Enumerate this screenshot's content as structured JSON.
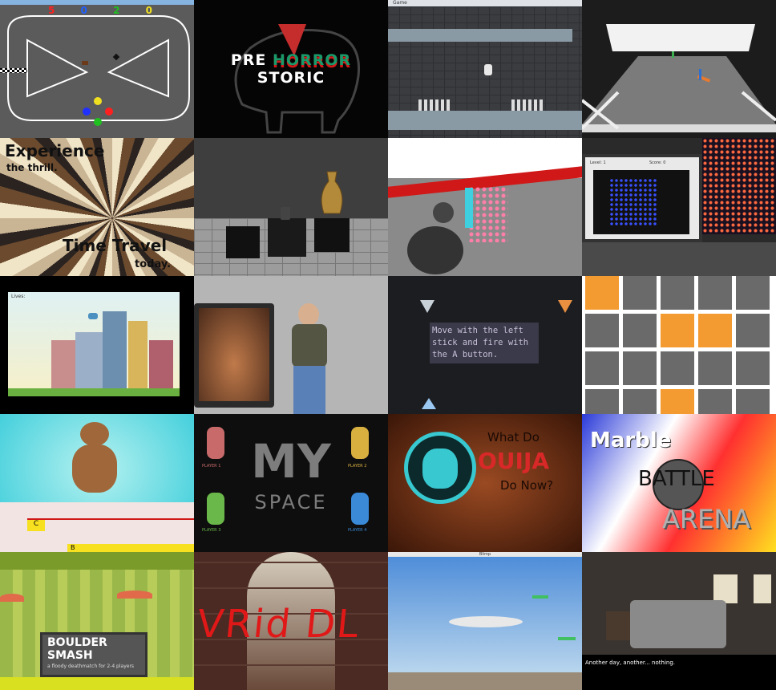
{
  "tiles": [
    {
      "id": "race-track",
      "scores": [
        "5",
        "0",
        "2",
        "0"
      ],
      "score_colors": [
        "#ff2020",
        "#2060ff",
        "#20c020",
        "#f0e020"
      ]
    },
    {
      "id": "prehorror",
      "title_pre": "PRE ",
      "title_horror": "HORROR",
      "title_post": " STORIC"
    },
    {
      "id": "platformer",
      "window_title": "Game"
    },
    {
      "id": "tabletop-3d"
    },
    {
      "id": "time-travel",
      "line1": "Experience",
      "line2": "the thrill.",
      "line3": "Time Travel",
      "line4": "today."
    },
    {
      "id": "museum-vase"
    },
    {
      "id": "red-arena"
    },
    {
      "id": "led-cube",
      "label_left": "Level: 1",
      "label_right": "Score: 0"
    },
    {
      "id": "city-flyer",
      "lives_label": "Lives:"
    },
    {
      "id": "vr-player"
    },
    {
      "id": "space-shooter",
      "instructions": "Move with the left stick and fire with the A button."
    },
    {
      "id": "orange-grid"
    },
    {
      "id": "bear-music",
      "note_c": "C",
      "note_b": "B"
    },
    {
      "id": "myspace",
      "word1": "MY",
      "word2": "SPACE",
      "players": [
        "PLAYER 1",
        "PLAYER 2",
        "PLAYER 3",
        "PLAYER 4"
      ]
    },
    {
      "id": "ouija",
      "line1": "What Do",
      "line2": "OUIJA",
      "line3": "Do Now?"
    },
    {
      "id": "marble-battle",
      "line1": "Marble",
      "line2": "BATTLE",
      "line3": "ARENA"
    },
    {
      "id": "boulder-smash",
      "title1": "BOULDER",
      "title2": "SMASH",
      "subtitle": "a floody deathmatch for 2-4 players"
    },
    {
      "id": "vrid-hall",
      "scrawl": "VRid DL"
    },
    {
      "id": "blimp-sky",
      "window_title": "Blimp"
    },
    {
      "id": "bedroom",
      "caption": "Another day, another... nothing."
    }
  ]
}
